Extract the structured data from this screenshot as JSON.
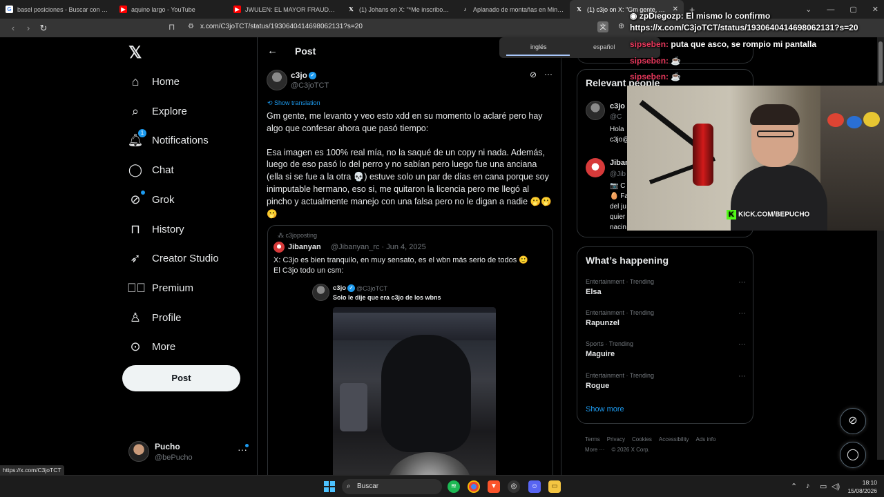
{
  "browser": {
    "tabs": [
      {
        "title": "basel posiciones - Buscar con Google",
        "icon": "google-icon",
        "color": "#4285f4"
      },
      {
        "title": "aquino largo - YouTube",
        "icon": "youtube-icon",
        "color": "#ff0000"
      },
      {
        "title": "JWULEN: EL MAYOR FRAUDE DE YOU",
        "icon": "youtube-icon",
        "color": "#ff0000"
      },
      {
        "title": "(1) Johans on X: \"*Me inscribo en el t",
        "icon": "x-icon",
        "color": "#000000"
      },
      {
        "title": "Aplanado de montañas en Minecraft",
        "icon": "tiktok-icon",
        "color": "#000000"
      },
      {
        "title": "(1) c3jo on X: \"Gm gente, me lev",
        "icon": "x-icon",
        "color": "#000000"
      }
    ],
    "url": "x.com/C3joTCT/status/1930640414698062131?s=20"
  },
  "translate_popup": {
    "lang1": "inglés",
    "lang2": "español"
  },
  "nav": {
    "home": "Home",
    "explore": "Explore",
    "notifications": "Notifications",
    "notifications_badge": "1",
    "chat": "Chat",
    "grok": "Grok",
    "history": "History",
    "creator_studio": "Creator Studio",
    "premium": "Premium",
    "profile": "Profile",
    "more": "More",
    "post": "Post"
  },
  "account": {
    "name": "Pucho",
    "handle": "@bePucho"
  },
  "main": {
    "title": "Post",
    "author_name": "c3jo",
    "author_handle": "@C3joTCT",
    "show_translation": "Show translation",
    "text_p1": "Gm gente, me levanto y veo esto xdd en su momento lo aclaré pero hay algo que confesar ahora que pasó tiempo:",
    "text_p2": "Esa imagen es 100% real mía, no la saqué de un copy ni nada. Además, luego de eso pasó lo del perro y no sabían pero luego fue una anciana (ella si se fue a la otra 💀) estuve solo un par de días en cana porque soy inimputable hermano, eso si, me quitaron la licencia pero me llegó al pincho y actualmente manejo con una falsa pero no le digan a nadie 🫢🫢🫢",
    "quote": {
      "context": "c3joposting",
      "name": "Jibanyan",
      "meta": "@Jibanyan_rc · Jun 4, 2025",
      "text_l1": "X: C3jo es bien tranquilo, en muy sensato, es el wbn más serio de todos 🙂",
      "text_l2": "El C3jo todo un csm:",
      "inner_name": "c3jo",
      "inner_handle": "@C3joTCT",
      "inner_text": "Solo le dije que era c3jo de los wbns"
    }
  },
  "right": {
    "relevant_title": "Relevant people",
    "rp1_name": "c3jo",
    "rp1_handle": "@C",
    "rp1_bio_1": "Hola",
    "rp1_bio_2": "c3jo@",
    "rp2_name": "Jiban",
    "rp2_handle": "@Jib",
    "rp2_l1": "📷 C",
    "rp2_l2": "🥚 Fa",
    "rp2_l3": "del ju",
    "rp2_l4": "quier",
    "rp2_l5": "nacin",
    "happening_title": "What’s happening",
    "trends": [
      {
        "meta": "Entertainment · Trending",
        "name": "Elsa"
      },
      {
        "meta": "Entertainment · Trending",
        "name": "Rapunzel"
      },
      {
        "meta": "Sports · Trending",
        "name": "Maguire"
      },
      {
        "meta": "Entertainment · Trending",
        "name": "Rogue"
      }
    ],
    "show_more": "Show more",
    "footer": [
      "Terms",
      "Privacy",
      "Cookies",
      "Accessibility",
      "Ads info",
      "More ···",
      "© 2026 X Corp."
    ]
  },
  "overlay": {
    "chat1_user": "zpDiegozp:",
    "chat1_msg": "El mismo lo confirmo",
    "chat1_url": "https://x.com/C3joTCT/status/1930640414698062131?s=20",
    "chat2_user": "sipseben:",
    "chat2_msg": "puta que asco, se rompio mi pantalla",
    "chat3_user": "sipseben:",
    "chat4_user": "sipseben:",
    "kick": "KICK.COM/BEPUCHO"
  },
  "status_url": "https://x.com/C3joTCT",
  "taskbar": {
    "search": "Buscar",
    "time": "18:10",
    "date": "15/08/2026"
  }
}
